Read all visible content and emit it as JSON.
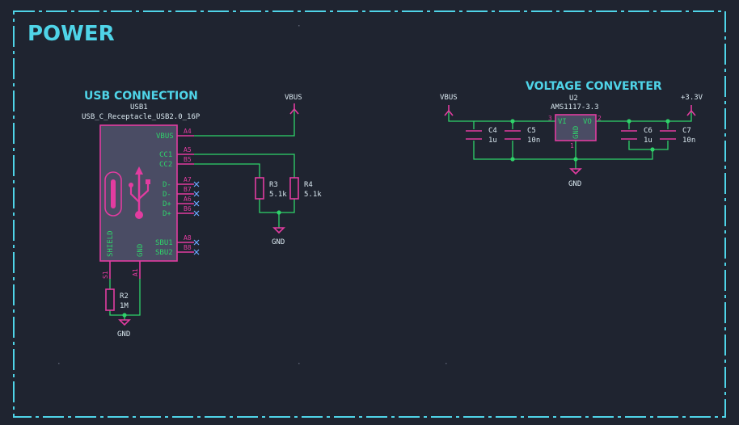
{
  "sheet": {
    "title": "POWER"
  },
  "usb": {
    "header": "USB CONNECTION",
    "ref": "USB1",
    "value": "USB_C_Receptacle_USB2.0_16P",
    "pins": {
      "vbus": {
        "name": "VBUS",
        "num": "A4"
      },
      "cc1": {
        "name": "CC1",
        "num": "A5"
      },
      "cc2": {
        "name": "CC2",
        "num": "B5"
      },
      "dm1": {
        "name": "D-",
        "num": "A7"
      },
      "dm2": {
        "name": "D-",
        "num": "B7"
      },
      "dp1": {
        "name": "D+",
        "num": "A6"
      },
      "dp2": {
        "name": "D+",
        "num": "B6"
      },
      "sbu1": {
        "name": "SBU1",
        "num": "A8"
      },
      "sbu2": {
        "name": "SBU2",
        "num": "B8"
      },
      "shield": {
        "name": "SHIELD",
        "num": "S1"
      },
      "gnd": {
        "name": "GND",
        "num": "A1"
      }
    }
  },
  "vreg": {
    "header": "VOLTAGE CONVERTER",
    "ref": "U2",
    "value": "AMS1117-3.3",
    "pins": {
      "vi": {
        "name": "VI",
        "num": "3"
      },
      "vo": {
        "name": "VO",
        "num": "2"
      },
      "gnd": {
        "name": "GND",
        "num": "1"
      }
    }
  },
  "components": {
    "r3": {
      "ref": "R3",
      "value": "5.1k"
    },
    "r4": {
      "ref": "R4",
      "value": "5.1k"
    },
    "r2": {
      "ref": "R2",
      "value": "1M"
    },
    "c4": {
      "ref": "C4",
      "value": "1u"
    },
    "c5": {
      "ref": "C5",
      "value": "10n"
    },
    "c6": {
      "ref": "C6",
      "value": "1u"
    },
    "c7": {
      "ref": "C7",
      "value": "10n"
    }
  },
  "power": {
    "vbus": "VBUS",
    "v33": "+3.3V",
    "gnd": "GND"
  },
  "colors": {
    "background": "#1f2430",
    "wire": "#2fd36a",
    "symbol": "#e23ca0",
    "text": "#d8e6ee",
    "border": "#4fd4e8",
    "no_connect": "#6aa8ff"
  }
}
